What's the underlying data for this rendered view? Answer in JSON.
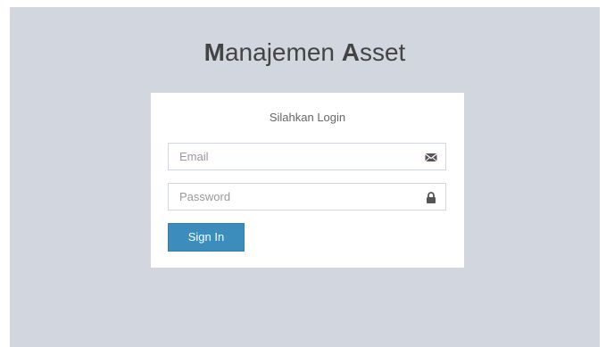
{
  "logo": {
    "word1_initial": "M",
    "word1_rest": "anajemen ",
    "word2_initial": "A",
    "word2_rest": "sset"
  },
  "login": {
    "message": "Silahkan Login",
    "email_placeholder": "Email",
    "email_icon": "envelope-icon",
    "password_placeholder": "Password",
    "password_icon": "lock-icon",
    "submit_label": "Sign In"
  },
  "colors": {
    "background": "#d2d6de",
    "card": "#ffffff",
    "button": "#3c8dbc",
    "title_text": "#444444"
  }
}
